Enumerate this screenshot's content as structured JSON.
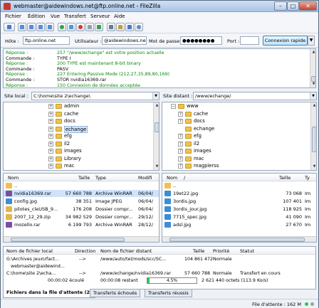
{
  "window": {
    "title": "webmaster@aidewindows.net@ftp.online.net - FileZilla"
  },
  "menu": [
    "Fichier",
    "Édition",
    "Vue",
    "Transfert",
    "Serveur",
    "Aide"
  ],
  "quickconnect": {
    "host_label": "Hôte :",
    "host": "ftp.online.net",
    "user_label": "Utilisateur :",
    "user": "@aidewindows.net",
    "pass_label": "Mot de passe :",
    "pass": "●●●●●●●●",
    "port_label": "Port :",
    "port": "",
    "button": "Connexion rapide"
  },
  "log": [
    {
      "k": "Réponse :",
      "m": "257 \"/www/echange\" est votre position actuelle",
      "c": "#0a8a0a"
    },
    {
      "k": "Commande :",
      "m": "TYPE I",
      "c": "#000000"
    },
    {
      "k": "Réponse :",
      "m": "200 TYPE est maintenant 8-bit binary",
      "c": "#0a8a0a"
    },
    {
      "k": "Commande :",
      "m": "PASV",
      "c": "#000000"
    },
    {
      "k": "Réponse :",
      "m": "227 Entering Passive Mode (212,27,35,89,80,169)",
      "c": "#0a8a0a"
    },
    {
      "k": "Commande :",
      "m": "STOR nvidia16369.rar",
      "c": "#000000"
    },
    {
      "k": "Réponse :",
      "m": "150 Connexion de données acceptée",
      "c": "#0a8a0a"
    }
  ],
  "local": {
    "label": "Site local :",
    "path": "C:\\home\\site 2\\echange\\",
    "tree": [
      {
        "name": "admin",
        "exp": "+"
      },
      {
        "name": "cache",
        "exp": "+"
      },
      {
        "name": "docs",
        "exp": "+"
      },
      {
        "name": "echange",
        "exp": "+",
        "sel": true
      },
      {
        "name": "efg",
        "exp": "+"
      },
      {
        "name": "il2",
        "exp": "+"
      },
      {
        "name": "images",
        "exp": "+"
      },
      {
        "name": "Library",
        "exp": "+"
      },
      {
        "name": "mac",
        "exp": "+"
      }
    ],
    "headers": [
      "Nom",
      "Taille",
      "Type",
      "Modifi"
    ],
    "files": [
      {
        "name": "..",
        "size": "",
        "type": "",
        "mod": "",
        "icon": "#f0c24d"
      },
      {
        "name": "nvidia16369.rar",
        "size": "57 660 788",
        "type": "Archive WinRAR",
        "mod": "06/04/",
        "icon": "#7a4fa3",
        "sel": true
      },
      {
        "name": "config.jpg",
        "size": "38 351",
        "type": "Image JPEG",
        "mod": "06/04/",
        "icon": "#3b8ed4"
      },
      {
        "name": "pilotes_cleUSB_9...",
        "size": "176 208",
        "type": "Dossier compr...",
        "mod": "06/04/",
        "icon": "#e3b64a"
      },
      {
        "name": "2007_12_29.zip",
        "size": "34 982 529",
        "type": "Dossier compr...",
        "mod": "29/12/",
        "icon": "#e3b64a"
      },
      {
        "name": "mozello.rar",
        "size": "6 199 793",
        "type": "Archive WinRAR",
        "mod": "28/12/",
        "icon": "#7a4fa3"
      }
    ]
  },
  "remote": {
    "label": "Site distant :",
    "path": "/www/echange/",
    "tree": [
      {
        "name": "www",
        "exp": "−",
        "root": true
      },
      {
        "name": "cache",
        "exp": "?"
      },
      {
        "name": "docs",
        "exp": "?"
      },
      {
        "name": "echange",
        "exp": "",
        "sel": false
      },
      {
        "name": "efg",
        "exp": "?"
      },
      {
        "name": "il2",
        "exp": "?"
      },
      {
        "name": "images",
        "exp": "?"
      },
      {
        "name": "mac",
        "exp": "?"
      },
      {
        "name": "magpierss",
        "exp": "?"
      }
    ],
    "headers": [
      "Nom",
      "/",
      "Taille",
      "Ty"
    ],
    "files": [
      {
        "name": "..",
        "size": "",
        "type": "",
        "icon": "#f0c24d"
      },
      {
        "name": "19et22.jpg",
        "size": "73 068",
        "type": "Im",
        "icon": "#3b8ed4"
      },
      {
        "name": "3ordis.jpg",
        "size": "107 401",
        "type": "Im",
        "icon": "#3b8ed4"
      },
      {
        "name": "3ordis_jour.jpg",
        "size": "118 925",
        "type": "Im",
        "icon": "#3b8ed4"
      },
      {
        "name": "7715_spec.jpg",
        "size": "41 090",
        "type": "Im",
        "icon": "#3b8ed4"
      },
      {
        "name": "adsl.jpg",
        "size": "27 670",
        "type": "Im",
        "icon": "#3b8ed4"
      }
    ]
  },
  "queue": {
    "headers": [
      "Nom de fichier local",
      "Direction",
      "Nom de fichier distant",
      "Taille",
      "Priorité",
      "Statut"
    ],
    "rows": [
      {
        "local": "G:\\Archives jeux\\rfact...",
        "dir": "-->",
        "remote": "/www/auto/tel/mods/scc/SC...",
        "size": "104 861 472",
        "prio": "Normale",
        "status": ""
      },
      {
        "local": "webmaster@aidewind...",
        "dir": "",
        "remote": "",
        "size": "",
        "prio": "",
        "status": ""
      },
      {
        "local": "C:\\home\\site 2\\echa...",
        "dir": "-->",
        "remote": "/www/echange/nvidia16369.rar",
        "size": "57 660 788",
        "prio": "Normale",
        "status": "Transfert en cours"
      }
    ],
    "progress": {
      "elapsed": "00:00:02 écoulé",
      "left": "00:00:08 restant",
      "percent_text": "4.5%",
      "percent": 4.5,
      "bytes": "2 621 440 octets (113.9 Ko/s)"
    }
  },
  "tabs": [
    "Fichiers dans la file d'attente (2)",
    "Transferts échoués",
    "Transferts réussis"
  ],
  "status": {
    "queue": "File d'attente : 162 M"
  },
  "colors": {
    "accent": "#3c7fb1",
    "selection": "#cfe3fb",
    "log_green": "#0a8a0a"
  }
}
